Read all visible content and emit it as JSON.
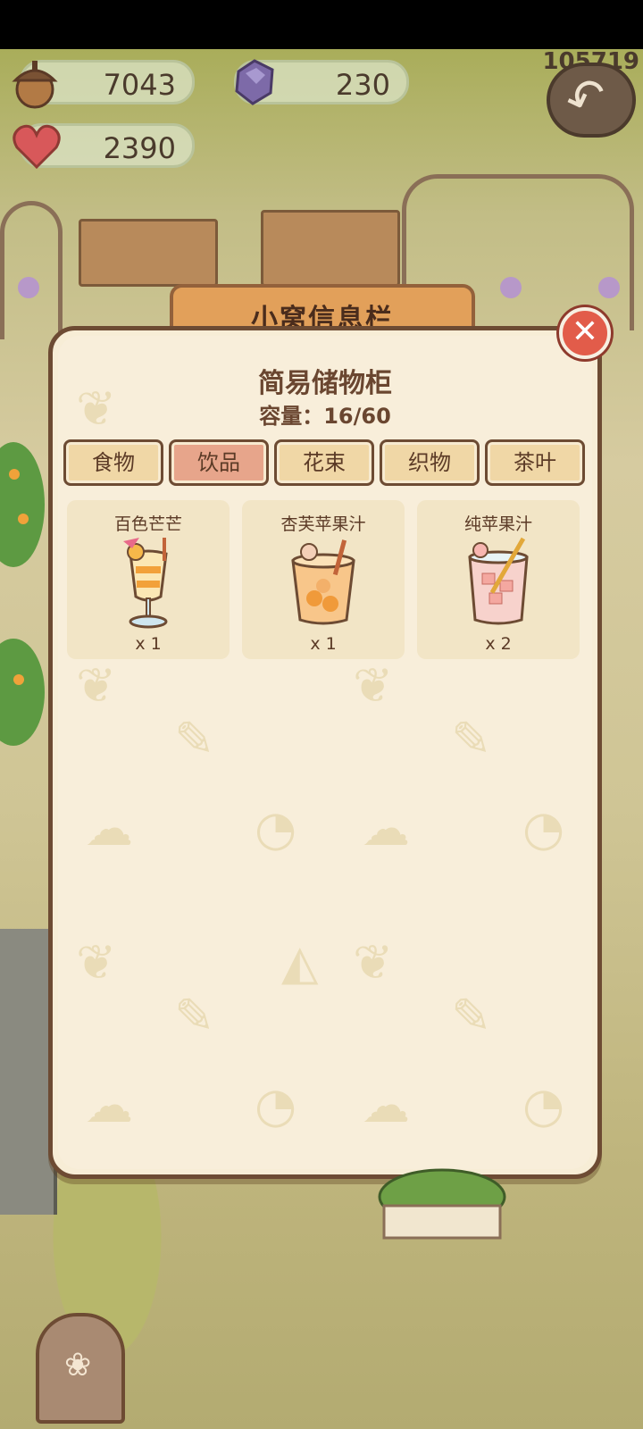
{
  "top_counter": "105719",
  "resources": {
    "acorns": {
      "icon": "acorn-icon",
      "value": "7043"
    },
    "gems": {
      "icon": "gem-icon",
      "value": "230"
    },
    "hearts": {
      "icon": "heart-icon",
      "value": "2390"
    }
  },
  "banner": {
    "title": "小窝信息栏"
  },
  "panel": {
    "title": "简易储物柜",
    "capacity": "容量：16/60",
    "tabs": [
      {
        "label": "食物",
        "active": false
      },
      {
        "label": "饮品",
        "active": true
      },
      {
        "label": "花束",
        "active": false
      },
      {
        "label": "织物",
        "active": false
      },
      {
        "label": "茶叶",
        "active": false
      }
    ],
    "items": [
      {
        "name": "百色芒芒",
        "qty": "x 1",
        "icon": "mango-parfait-drink-icon"
      },
      {
        "name": "杏芙苹果汁",
        "qty": "x 1",
        "icon": "apricot-apple-juice-icon"
      },
      {
        "name": "纯苹果汁",
        "qty": "x 2",
        "icon": "pure-apple-juice-icon"
      }
    ]
  },
  "colors": {
    "panel_bg": "#f8eeda",
    "panel_border": "#6d4b33",
    "tab_bg": "#f0d7a6",
    "tab_active_bg": "#e7a58b",
    "close_btn": "#e25c4a"
  }
}
